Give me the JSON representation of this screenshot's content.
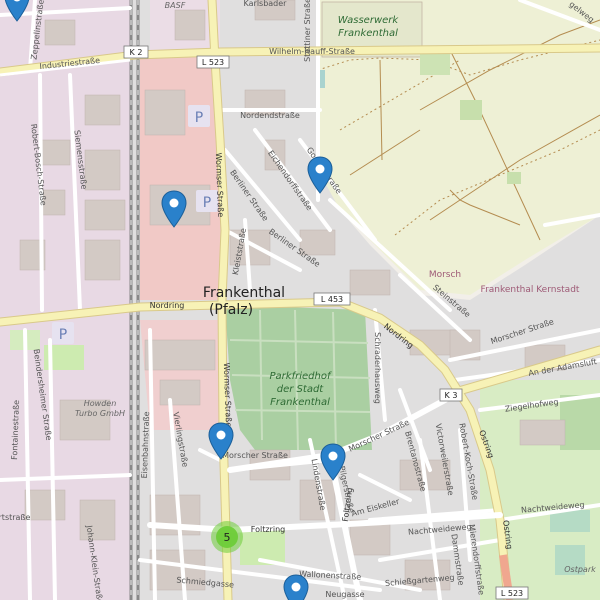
{
  "map": {
    "town_label_line1": "Frankenthal",
    "town_label_line2": "(Pfalz)",
    "park_label_lines": [
      "Parkfriedhof",
      "der Stadt",
      "Frankenthal"
    ],
    "waterworks_label_lines": [
      "Wasserwerk",
      "Frankenthal"
    ],
    "company_label_lines": [
      "Howden",
      "Turbo GmbH"
    ],
    "basf": "BASF",
    "morsch": "Morsch",
    "kernstadt": "Frankenthal Kernstadt",
    "ostpark": "Ostpark",
    "parking_symbol": "P",
    "shields": {
      "k2": "K 2",
      "l523_top": "L 523",
      "l453": "L 453",
      "k3": "K 3",
      "l523_bottom": "L 523"
    },
    "streets": {
      "industriestrasse": "Industriestraße",
      "wilhelm_hauff": "Wilhelm-Hauff-Straße",
      "karlsbader": "Karlsbader",
      "stettiner": "Stettiner Straße",
      "zeppelin": "Zeppelinstraße",
      "robert_bosch": "Robert-Bosch-Straße",
      "siemens": "Siemensstraße",
      "nordend": "Nordendstraße",
      "wormser_top": "Wormser Straße",
      "wormser_bottom": "Wormser Straße",
      "berliner_1": "Berliner Straße",
      "berliner_2": "Berliner Straße",
      "eichendorff": "Eichendorffstraße",
      "goethe": "Goethestraße",
      "kleist": "Kleiststraße",
      "nordring_left": "Nordring",
      "nordring_right": "Nordring",
      "steinstrasse": "Steinstraße",
      "morscher_east": "Morscher Straße",
      "morscher_mid": "Morscher Straße",
      "morscher_south": "Morscher Straße",
      "an_der_adamsluft": "An der Adamsluft",
      "ziegelhofweg": "Ziegelhofweg",
      "schraderhausweg": "Schraderhausweg",
      "beindersheimer": "Beindersheimer Straße",
      "fontainestrasse": "Fontainestraße",
      "eisenbahnstrasse": "Eisenbahnstraße",
      "vierlingstrasse": "Vierlingstraße",
      "lindenstrasse": "Lindenstraße",
      "foltzring_left": "Foltzring",
      "foltzring_right": "Foltzring",
      "am_eiskeller": "Am Eiskeller",
      "brentanostrasse": "Brentanostraße",
      "victorwelkstrasse": "Victorweilerstraße",
      "robert_koch": "Robert-Koch-Straße",
      "ostring": "Ostring",
      "ostring_2": "Ostring",
      "nachtweideweg": "Nachtweideweg",
      "nachtweideweg_2": "Nachtweideweg",
      "dammstrasse": "Dammstraße",
      "mierendorffstrasse": "Mierendorffstraße",
      "schiessgartenweg": "Schießgartenweg",
      "schmiedgasse": "Schmiedgasse",
      "wallonenstrasse": "Wallonenstraße",
      "neugasse": "Neugasse",
      "johann_klein": "Johann-Klein-Straße",
      "sertstrasse": "ertstraße",
      "strasse_top_right": "gelweg",
      "pilger": "Pilgerstraße"
    },
    "cluster_count": "5"
  }
}
